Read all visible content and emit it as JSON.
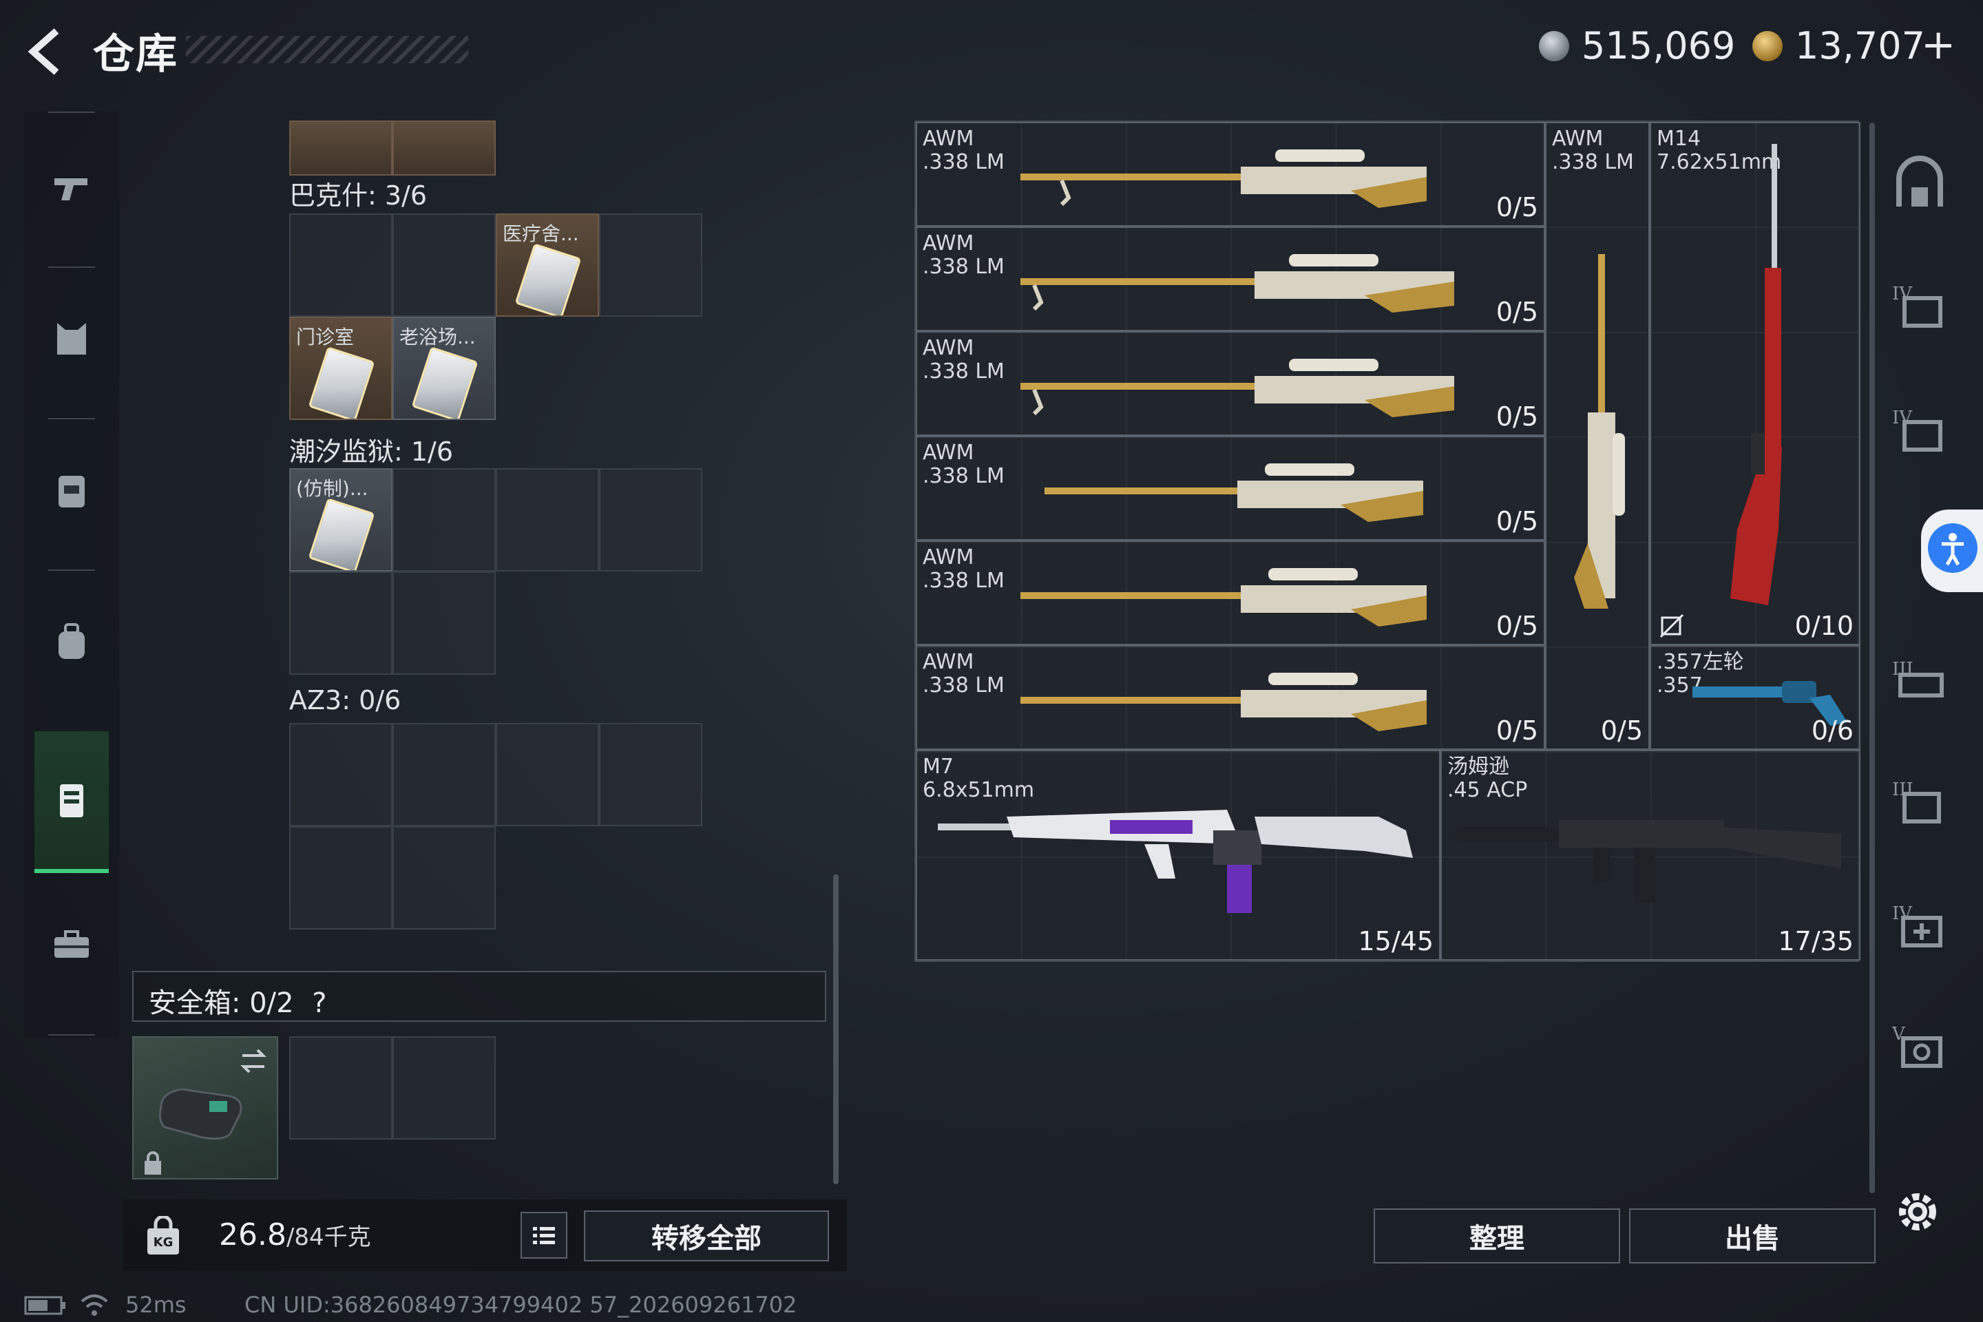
{
  "header": {
    "title": "仓库",
    "currency_silver": "515,069",
    "currency_gold": "13,707",
    "plus_label": "+"
  },
  "left_nav": {
    "items": [
      "pistol-icon",
      "armor-icon",
      "vest-icon",
      "backpack-icon",
      "case-icon",
      "toolbox-icon"
    ],
    "active_index": 4
  },
  "inventory": {
    "sections": [
      {
        "label": "巴克什: 3/6"
      },
      {
        "label": "潮汐监狱: 1/6"
      },
      {
        "label": "AZ3: 0/6"
      }
    ],
    "items": [
      {
        "name": "医疗舍..."
      },
      {
        "name": "门诊室"
      },
      {
        "name": "老浴场..."
      },
      {
        "name": "(仿制)..."
      }
    ]
  },
  "safe_box": {
    "label": "安全箱: 0/2",
    "help": "?"
  },
  "bottom_left": {
    "weight": "26.8",
    "weight_max": "/84千克",
    "transfer_label": "转移全部"
  },
  "stash": {
    "weapons": [
      {
        "name": "AWM",
        "ammo": ".338 LM",
        "count": "0/5"
      },
      {
        "name": "AWM",
        "ammo": ".338 LM",
        "count": "0/5"
      },
      {
        "name": "AWM",
        "ammo": ".338 LM",
        "count": "0/5"
      },
      {
        "name": "AWM",
        "ammo": ".338 LM",
        "count": "0/5"
      },
      {
        "name": "AWM",
        "ammo": ".338 LM",
        "count": "0/5"
      },
      {
        "name": "AWM",
        "ammo": ".338 LM",
        "count": "0/5"
      },
      {
        "name": "AWM",
        "ammo": ".338 LM",
        "count": "0/5"
      },
      {
        "name": "M14",
        "ammo": "7.62x51mm",
        "count": "0/10"
      },
      {
        "name": ".357左轮",
        "ammo": ".357",
        "count": "0/6"
      },
      {
        "name": "M7",
        "ammo": "6.8x51mm",
        "count": "15/45"
      },
      {
        "name": "汤姆逊",
        "ammo": ".45 ACP",
        "count": "17/35"
      }
    ]
  },
  "actions": {
    "sort_label": "整理",
    "sell_label": "出售"
  },
  "status_bar": {
    "ping": "52ms",
    "uid": "CN UID:368260849734799402 57_202609261702"
  },
  "colors": {
    "accent_green": "#3fcf7f",
    "gold": "#c9a24a",
    "access_blue": "#2f7ef5"
  }
}
